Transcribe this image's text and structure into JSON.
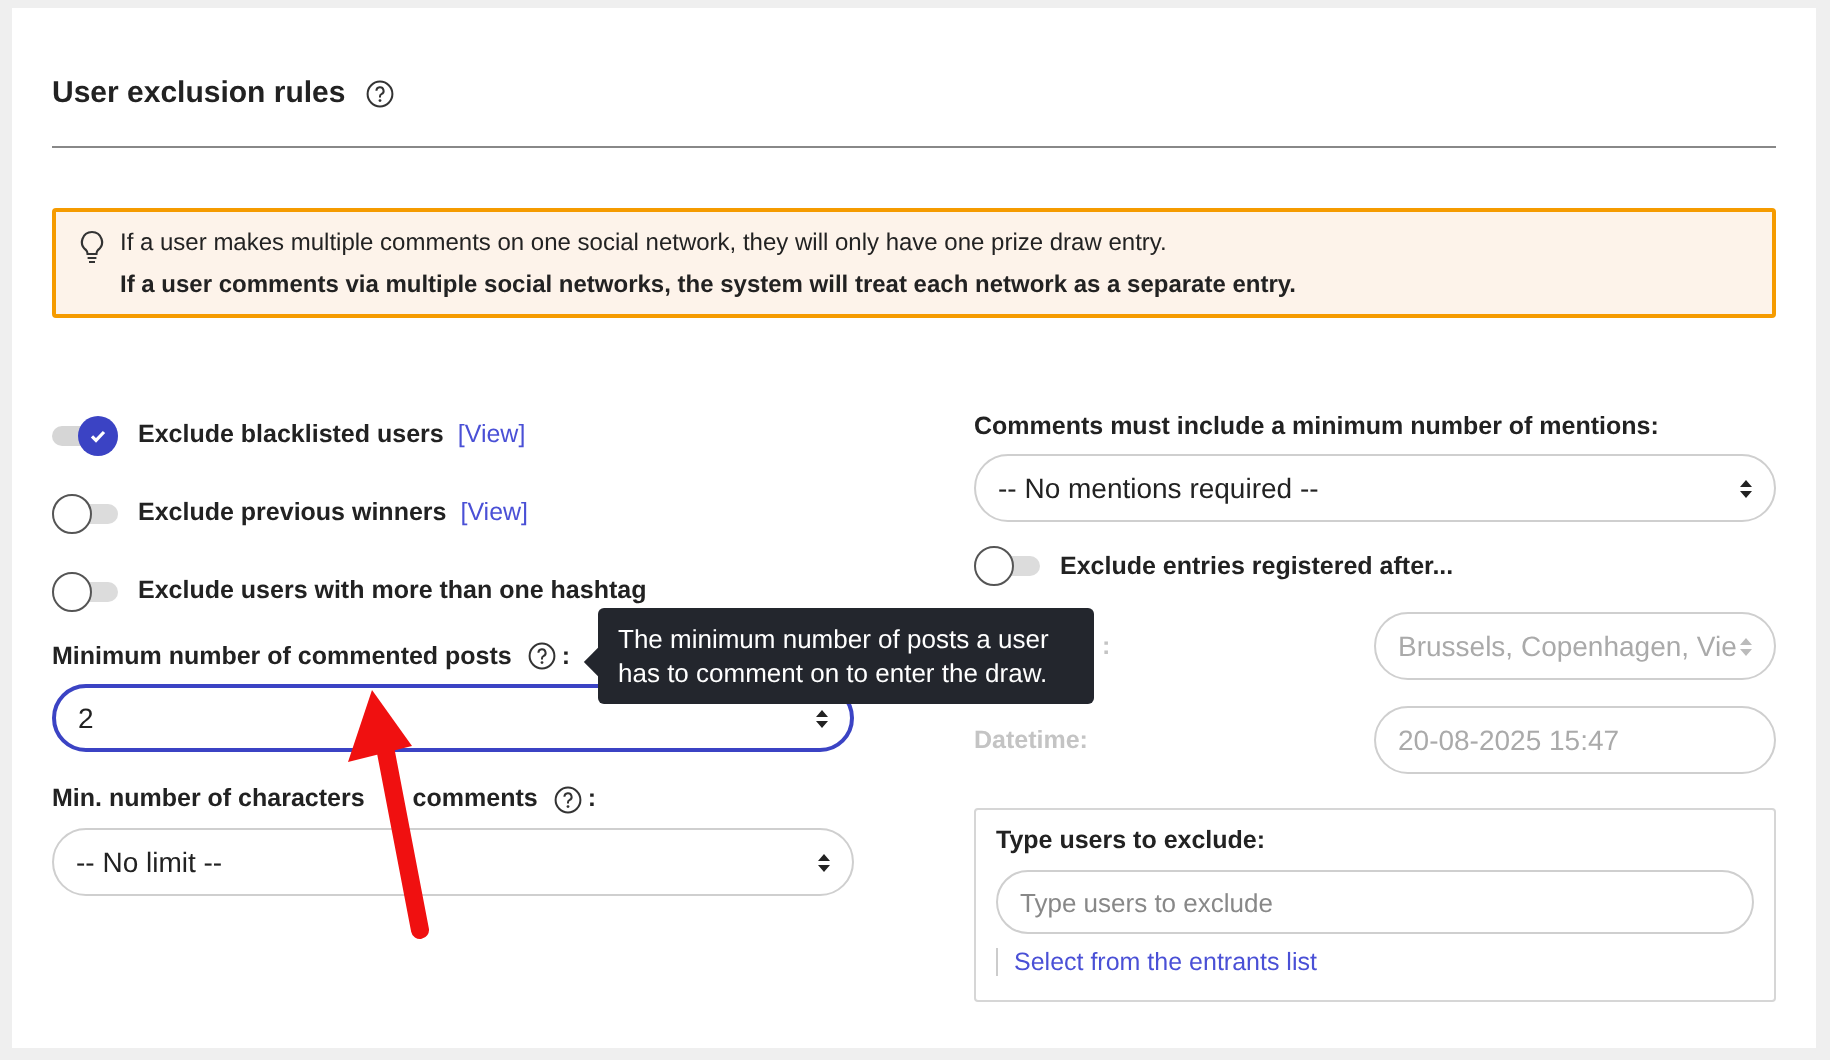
{
  "title": "User exclusion rules",
  "notice": {
    "lines": [
      {
        "text": "If a user makes multiple comments on one social network, they will only have one prize draw entry.",
        "bold": false
      },
      {
        "text": "If a user comments via multiple social networks, the system will treat each network as a separate entry.",
        "bold": true
      }
    ]
  },
  "toggles": [
    {
      "label": "Exclude blacklisted users",
      "link": "[View]",
      "checked": true
    },
    {
      "label": "Exclude previous winners",
      "link": "[View]",
      "checked": false
    },
    {
      "label": "Exclude users with more than one hashtag",
      "checked": false
    }
  ],
  "min_posts": {
    "label": "Minimum number of commented posts",
    "suffix": ":",
    "value": "2",
    "focused": true,
    "tooltip": "The minimum number of posts a user has to comment on to enter the draw."
  },
  "min_chars": {
    "label": "Min. number of characters",
    "label_end": "comments",
    "suffix": ":",
    "value": "-- No limit --",
    "focused": false
  },
  "mentions": {
    "label": "Comments must include a minimum number of mentions:",
    "value": "-- No mentions required --"
  },
  "registered_toggle": {
    "label": "Exclude entries registered after...",
    "checked": false
  },
  "timezone": {
    "label": ":",
    "value": "Brussels, Copenhagen, Vie",
    "disabled": true
  },
  "datetime": {
    "label": "Datetime:",
    "value": "20-08-2025 15:47",
    "disabled": true
  },
  "exclude_users": {
    "label": "Type users to exclude:",
    "placeholder": "Type users to exclude",
    "link": "Select from the entrants list"
  }
}
